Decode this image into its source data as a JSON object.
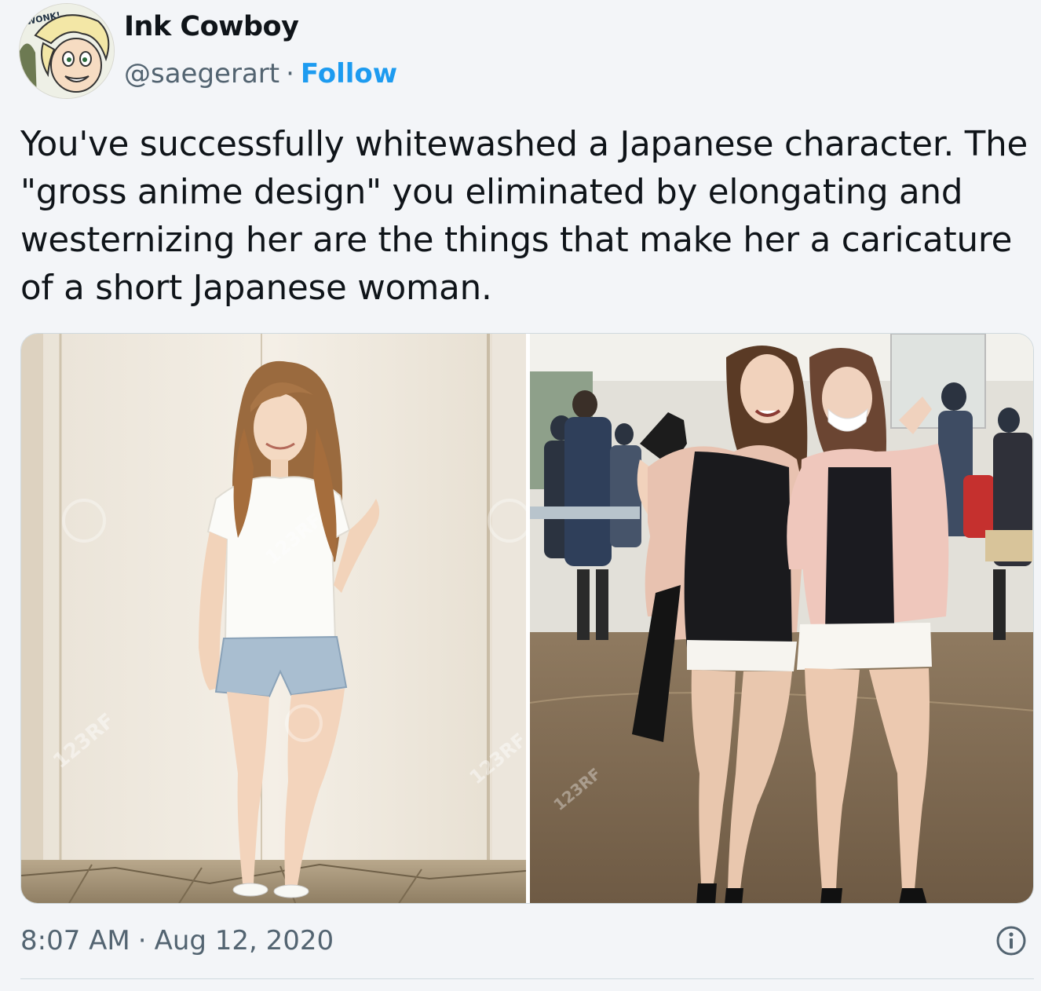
{
  "author": {
    "name": "Ink Cowboy",
    "handle": "@saegerart",
    "separator": "·",
    "follow_label": "Follow",
    "avatar_caption": "WONK!"
  },
  "tweet": {
    "text": "You've successfully whitewashed a Japanese character. The \"gross anime design\" you eliminated by elongating and westernizing her are the things that make her a caricature of a short Japanese woman."
  },
  "media": {
    "watermark": "123RF",
    "photos": [
      {
        "name": "photo-woman-standing-against-wall"
      },
      {
        "name": "photo-two-women-posing"
      }
    ]
  },
  "timestamp": {
    "time": "8:07 AM",
    "separator": "·",
    "date": "Aug 12, 2020"
  },
  "icons": {
    "info": "info-icon"
  },
  "colors": {
    "accent": "#1d9bf0",
    "secondary_text": "#536471",
    "border": "#cfd9de"
  }
}
